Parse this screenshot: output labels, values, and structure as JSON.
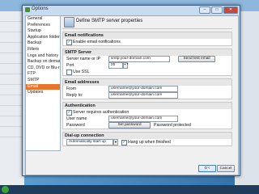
{
  "window": {
    "title": "Options",
    "minimize": "–",
    "maximize": "□",
    "close": "✕"
  },
  "nav": {
    "items": [
      {
        "label": "General"
      },
      {
        "label": "Preferences"
      },
      {
        "label": "Startup"
      },
      {
        "label": "Application folders"
      },
      {
        "label": "Backup"
      },
      {
        "label": "Filters"
      },
      {
        "label": "Logs and history"
      },
      {
        "label": "Backup on demand"
      },
      {
        "label": "CD, DVD or Blu-ray"
      },
      {
        "label": "FTP"
      },
      {
        "label": "SMTP"
      },
      {
        "label": "Email"
      },
      {
        "label": "Updates"
      }
    ],
    "selected_index": 11
  },
  "header": {
    "title": "Define SMTP server properties"
  },
  "email_notifications": {
    "section": "Email notifications",
    "enable_label": "Enable email notifications",
    "enable_checked": true
  },
  "smtp": {
    "section": "SMTP Server",
    "server_label": "Server name or IP",
    "server_value": "smtp.your-domain.com",
    "send_test": "Send test email",
    "port_label": "Port",
    "port_value": "25",
    "ssl_label": "Use SSL",
    "ssl_checked": false
  },
  "addresses": {
    "section": "Email addresses",
    "from_label": "From",
    "from_value": "username@your-domain.com",
    "reply_label": "Reply to:",
    "reply_value": "username@your-domain.com"
  },
  "auth": {
    "section": "Authentication",
    "requires_label": "Server requires authentication",
    "requires_checked": true,
    "user_label": "User name",
    "user_value": "username@your-domain.com",
    "password_label": "Password",
    "set_password": "Set password",
    "password_status": "Password protected"
  },
  "dialup": {
    "section": "Dial-up connection",
    "mode_value": "Automatically start up",
    "hangup_label": "Hang up when finished",
    "hangup_checked": true
  },
  "footer": {
    "ok": "OK",
    "cancel": "Cancel"
  },
  "taskbar": {
    "tray_text": ""
  }
}
